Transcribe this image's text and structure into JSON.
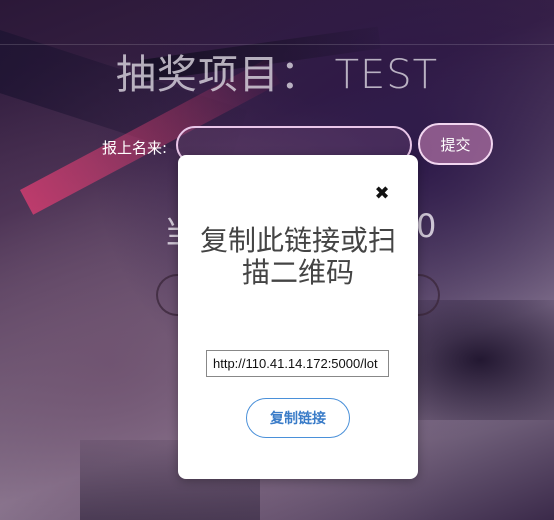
{
  "page": {
    "title": "抽奖项目： TEST",
    "form_label": "报上名来:",
    "submit_label": "提交",
    "count_left": "当",
    "count_right": "0"
  },
  "modal": {
    "close_glyph": "✖",
    "title": "复制此链接或扫描二维码",
    "link_value": "http://110.41.14.172:5000/lot",
    "copy_label": "复制链接"
  },
  "colors": {
    "accent_blue": "#4a90d9",
    "input_border": "#e9c6e9",
    "submit_bg": "#aa6ea0"
  }
}
